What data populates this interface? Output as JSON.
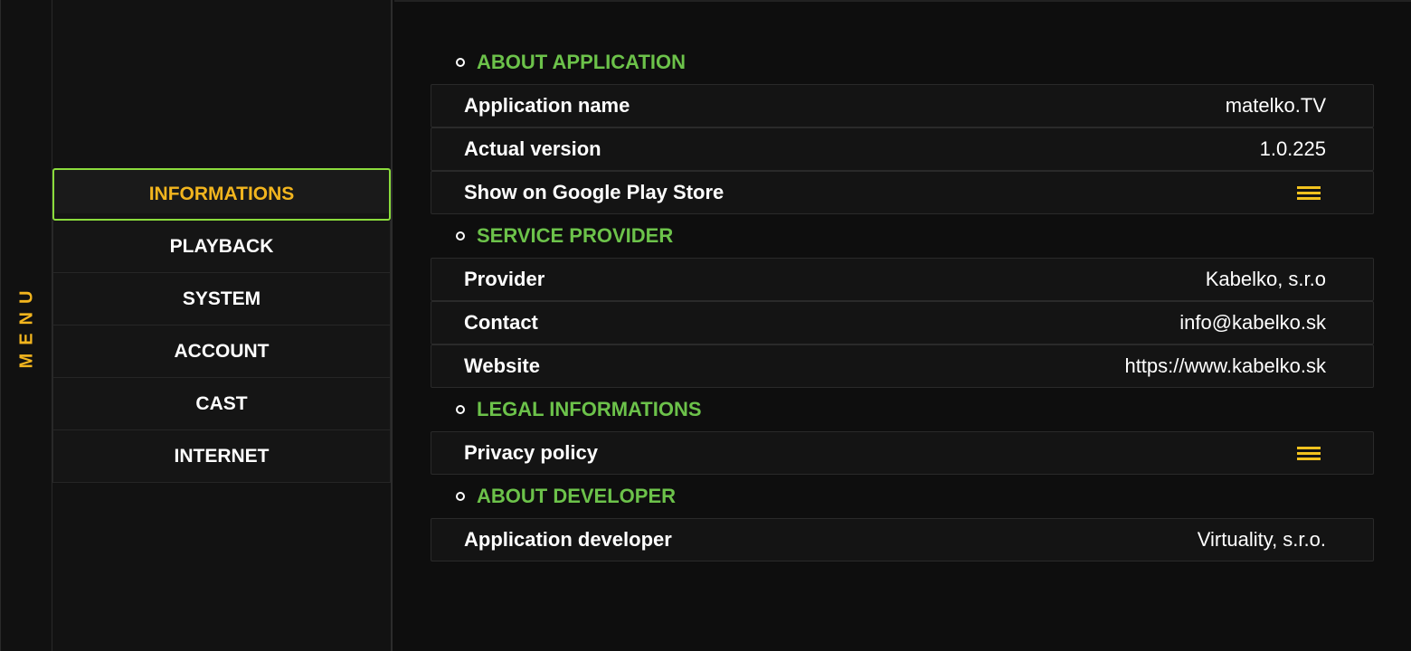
{
  "rail": {
    "label": "MENU"
  },
  "sidebar": {
    "items": [
      {
        "label": "INFORMATIONS",
        "active": true
      },
      {
        "label": "PLAYBACK"
      },
      {
        "label": "SYSTEM"
      },
      {
        "label": "ACCOUNT"
      },
      {
        "label": "CAST"
      },
      {
        "label": "INTERNET"
      }
    ]
  },
  "sections": {
    "about_app": {
      "title": "ABOUT APPLICATION",
      "app_name": {
        "label": "Application name",
        "value": "matelko.TV"
      },
      "version": {
        "label": "Actual version",
        "value": "1.0.225"
      },
      "store": {
        "label": "Show on Google Play Store",
        "icon": "menu-icon"
      }
    },
    "provider": {
      "title": "SERVICE PROVIDER",
      "name": {
        "label": "Provider",
        "value": "Kabelko, s.r.o"
      },
      "contact": {
        "label": "Contact",
        "value": "info@kabelko.sk"
      },
      "website": {
        "label": "Website",
        "value": "https://www.kabelko.sk"
      }
    },
    "legal": {
      "title": "LEGAL INFORMATIONS",
      "privacy": {
        "label": "Privacy policy",
        "icon": "menu-icon"
      }
    },
    "developer": {
      "title": "ABOUT DEVELOPER",
      "dev": {
        "label": "Application developer",
        "value": "Virtuality, s.r.o."
      }
    }
  },
  "colors": {
    "accent_yellow": "#f2b51e",
    "accent_green": "#6cc24a",
    "focus_border": "#8bdc3c",
    "background": "#0e0e0e"
  }
}
